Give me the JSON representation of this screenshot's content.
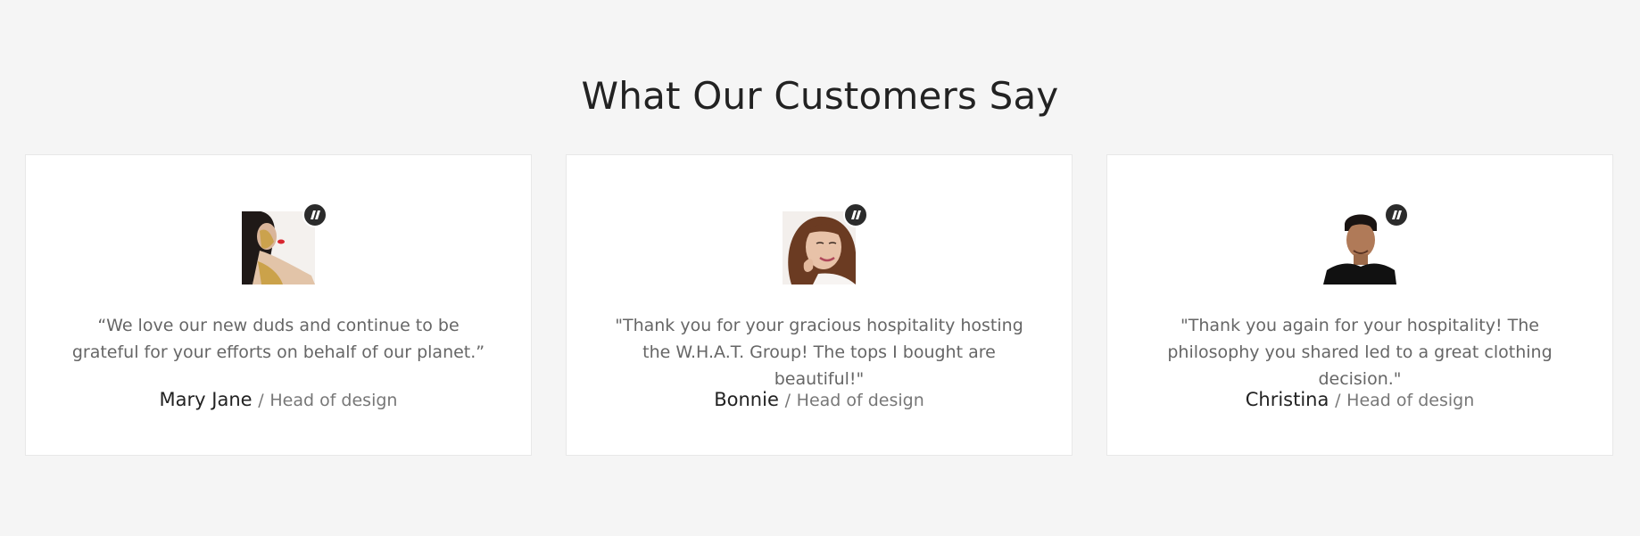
{
  "section": {
    "title": "What Our Customers Say"
  },
  "testimonials": [
    {
      "quote": "“We love our new duds and continue to be grateful for your efforts on behalf of our planet.”",
      "name": "Mary Jane",
      "separator": "/",
      "role": "Head of design",
      "avatar_icon": "woman-gold-paint-portrait"
    },
    {
      "quote": "\"Thank you for your gracious hospitality hosting the W.H.A.T. Group! The tops I bought are beautiful!\"",
      "name": "Bonnie",
      "separator": "/",
      "role": "Head of design",
      "avatar_icon": "smiling-woman-portrait"
    },
    {
      "quote": "\"Thank you again for your hospitality! The philosophy you shared led to a great clothing decision.\"",
      "name": "Christina",
      "separator": "/",
      "role": "Head of design",
      "avatar_icon": "man-black-shirt-portrait"
    }
  ],
  "colors": {
    "page_background": "#f5f5f5",
    "card_background": "#ffffff",
    "badge": "#2b2b2b",
    "title_text": "#222222",
    "body_text": "#666666"
  }
}
